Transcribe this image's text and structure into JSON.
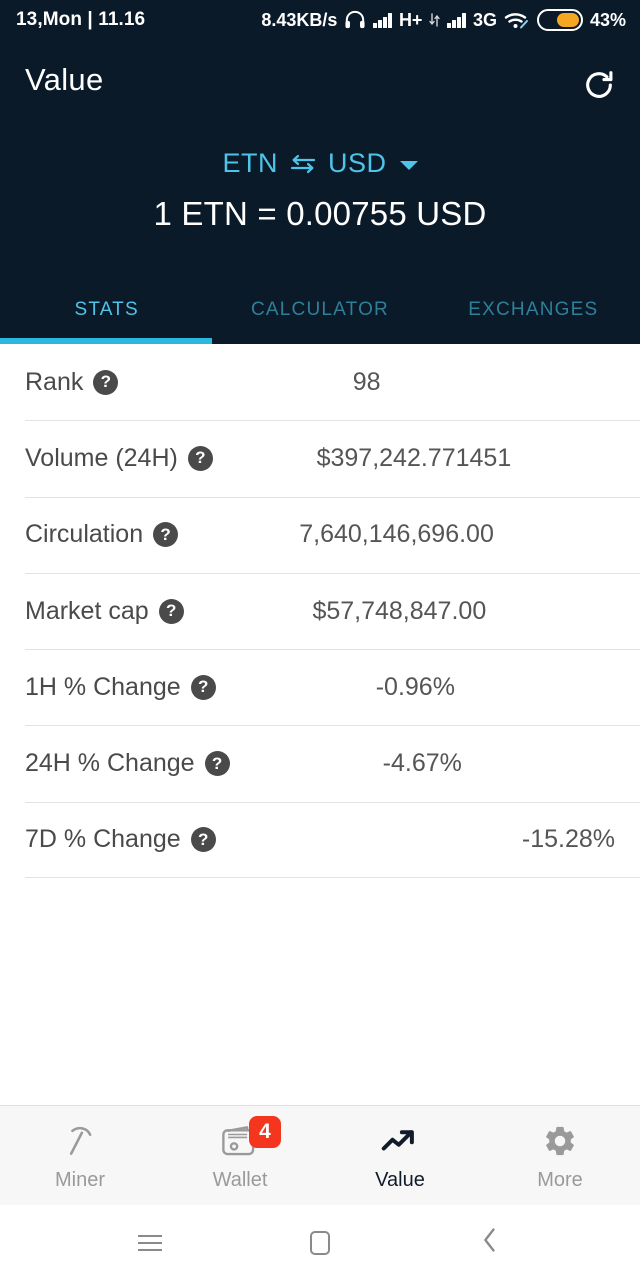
{
  "status_bar": {
    "date_time": "13,Mon | 11.16",
    "network_speed": "8.43KB/s",
    "network_type_1": "H+",
    "network_type_2": "3G",
    "battery_percent": "43%",
    "icons": [
      "headphone-icon",
      "signal-bars-icon",
      "signal-bars-icon",
      "wifi-icon",
      "battery-icon"
    ]
  },
  "header": {
    "title": "Value",
    "refresh_icon": "refresh-icon",
    "pair": {
      "from": "ETN",
      "swap_icon": "swap-arrows-icon",
      "to": "USD",
      "caret_icon": "chevron-down-icon"
    },
    "rate": "1 ETN = 0.00755 USD"
  },
  "tabs": [
    {
      "label": "STATS",
      "active": true
    },
    {
      "label": "CALCULATOR",
      "active": false
    },
    {
      "label": "EXCHANGES",
      "active": false
    }
  ],
  "stats": [
    {
      "label": "Rank",
      "help": "?",
      "value": "98"
    },
    {
      "label": "Volume (24H)",
      "help": "?",
      "value": "$397,242.771451"
    },
    {
      "label": "Circulation",
      "help": "?",
      "value": "7,640,146,696.00"
    },
    {
      "label": "Market cap",
      "help": "?",
      "value": "$57,748,847.00"
    },
    {
      "label": "1H % Change",
      "help": "?",
      "value": "-0.96%"
    },
    {
      "label": "24H % Change",
      "help": "?",
      "value": "-4.67%"
    },
    {
      "label": "7D % Change",
      "help": "?",
      "value": "-15.28%"
    }
  ],
  "bottom_nav": [
    {
      "label": "Miner",
      "icon": "pickaxe-icon",
      "active": false,
      "badge": ""
    },
    {
      "label": "Wallet",
      "icon": "wallet-icon",
      "active": false,
      "badge": "4"
    },
    {
      "label": "Value",
      "icon": "trending-up-icon",
      "active": true,
      "badge": ""
    },
    {
      "label": "More",
      "icon": "gear-icon",
      "active": false,
      "badge": ""
    }
  ],
  "android_nav": {
    "menu": "menu-icon",
    "home": "home-icon",
    "back": "back-icon"
  },
  "colors": {
    "header_bg": "#0b1a29",
    "accent_cyan": "#4fc3e8",
    "tab_inactive": "#2f7f99",
    "badge_red": "#f4361f",
    "battery_orange": "#f5a623"
  }
}
